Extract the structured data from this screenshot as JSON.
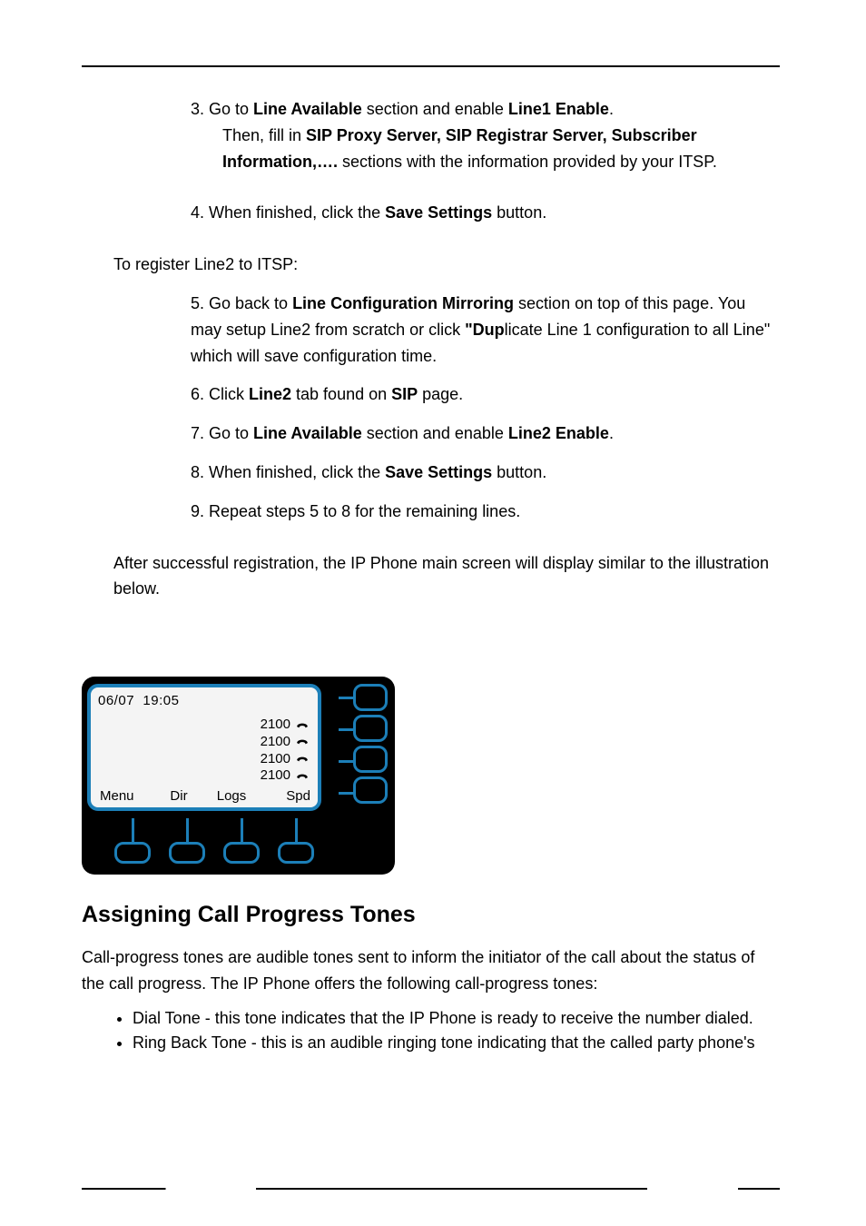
{
  "steps": {
    "s3": {
      "pre1": "3.   Go to ",
      "b1": "Line Available",
      "mid1": " section and enable ",
      "b2": "Line1 Enable",
      "post1": ".",
      "pre2": "Then, fill in ",
      "b3": "SIP Proxy Server, SIP Registrar Server, Subscriber Information,….",
      "post2": " sections with the information provided by your ITSP."
    },
    "s4": {
      "pre": "4.   When finished, click the ",
      "b": "Save Settings",
      "post": " button."
    },
    "head": "To register Line2 to ITSP:",
    "s5": {
      "pre1": "5.   Go back to ",
      "b1": "Line Configuration Mirroring",
      "mid1": " section on top of this page. You may setup Line2 from scratch or click ",
      "b2": "\"Dup",
      "post1": "licate Line 1 configuration to all Line\" which will save configuration time."
    },
    "s6": {
      "pre": "6.   Click ",
      "b1": "Line2",
      "mid": " tab found on ",
      "b2": "SIP",
      "post": " page."
    },
    "s7": {
      "pre": "7.   Go to ",
      "b1": "Line Available",
      "mid": " section and enable ",
      "b2": "Line2 Enable",
      "post": "."
    },
    "s8": {
      "pre": "8.   When finished, click the ",
      "b": "Save Settings",
      "post": " button."
    },
    "s9": "9.   Repeat steps 5 to 8 for the remaining lines.",
    "note": "After successful registration, the IP Phone main screen will display similar to the illustration below."
  },
  "phone": {
    "date": "06/07",
    "time": "19:05",
    "ext": "2100",
    "soft": [
      "Menu",
      "Dir",
      "Logs",
      "Spd"
    ]
  },
  "h2": "Assigning Call Progress Tones",
  "p": "Call-progress tones are audible tones sent to inform the initiator of the call about the status of the call progress. The IP Phone offers the following call-progress tones:",
  "tones": [
    "Dial Tone - this tone indicates that the IP Phone is ready to receive the number dialed.",
    "Ring Back Tone - this is an audible ringing tone indicating that the called party phone's"
  ]
}
